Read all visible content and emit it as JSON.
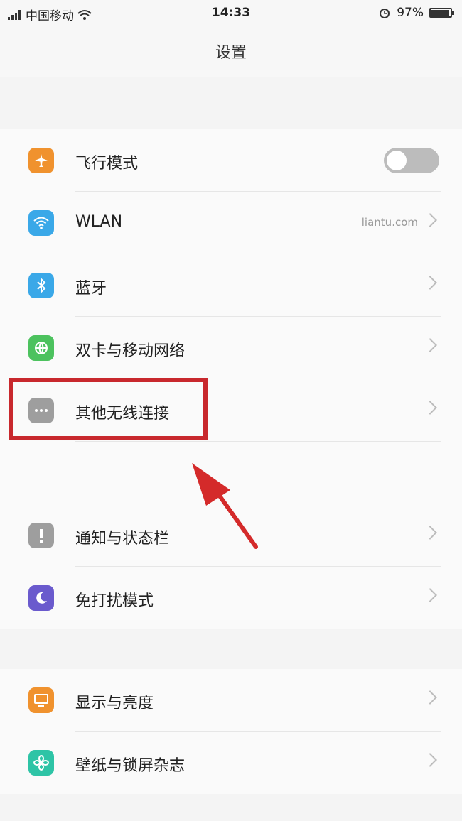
{
  "status_bar": {
    "carrier": "中国移动",
    "time": "14:33",
    "battery": "97%",
    "battery_level": 0.97
  },
  "header": {
    "title": "设置"
  },
  "group1": [
    {
      "label": "飞行模式",
      "icon": "airplane-icon",
      "color": "#f0922e",
      "control": "toggle",
      "toggle_on": false
    },
    {
      "label": "WLAN",
      "value": "liantu.com",
      "icon": "wifi-icon",
      "color": "#3aa8e8",
      "control": "chevron"
    },
    {
      "label": "蓝牙",
      "icon": "bluetooth-icon",
      "color": "#3aa8e8",
      "control": "chevron"
    },
    {
      "label": "双卡与移动网络",
      "icon": "globe-icon",
      "color": "#4cc25e",
      "control": "chevron"
    },
    {
      "label": "其他无线连接",
      "icon": "more-icon",
      "color": "#9e9e9e",
      "control": "chevron"
    },
    {
      "label": "通知与状态栏",
      "icon": "notification-icon",
      "color": "#9e9e9e",
      "control": "chevron"
    },
    {
      "label": "免打扰模式",
      "icon": "moon-icon",
      "color": "#6a5acd",
      "control": "chevron"
    }
  ],
  "group2": [
    {
      "label": "显示与亮度",
      "icon": "display-icon",
      "color": "#f0922e",
      "control": "chevron"
    },
    {
      "label": "壁纸与锁屏杂志",
      "icon": "flower-icon",
      "color": "#2ec4a6",
      "control": "chevron"
    }
  ],
  "colors": {
    "highlight": "#c8282d",
    "arrow": "#d42a2a"
  }
}
